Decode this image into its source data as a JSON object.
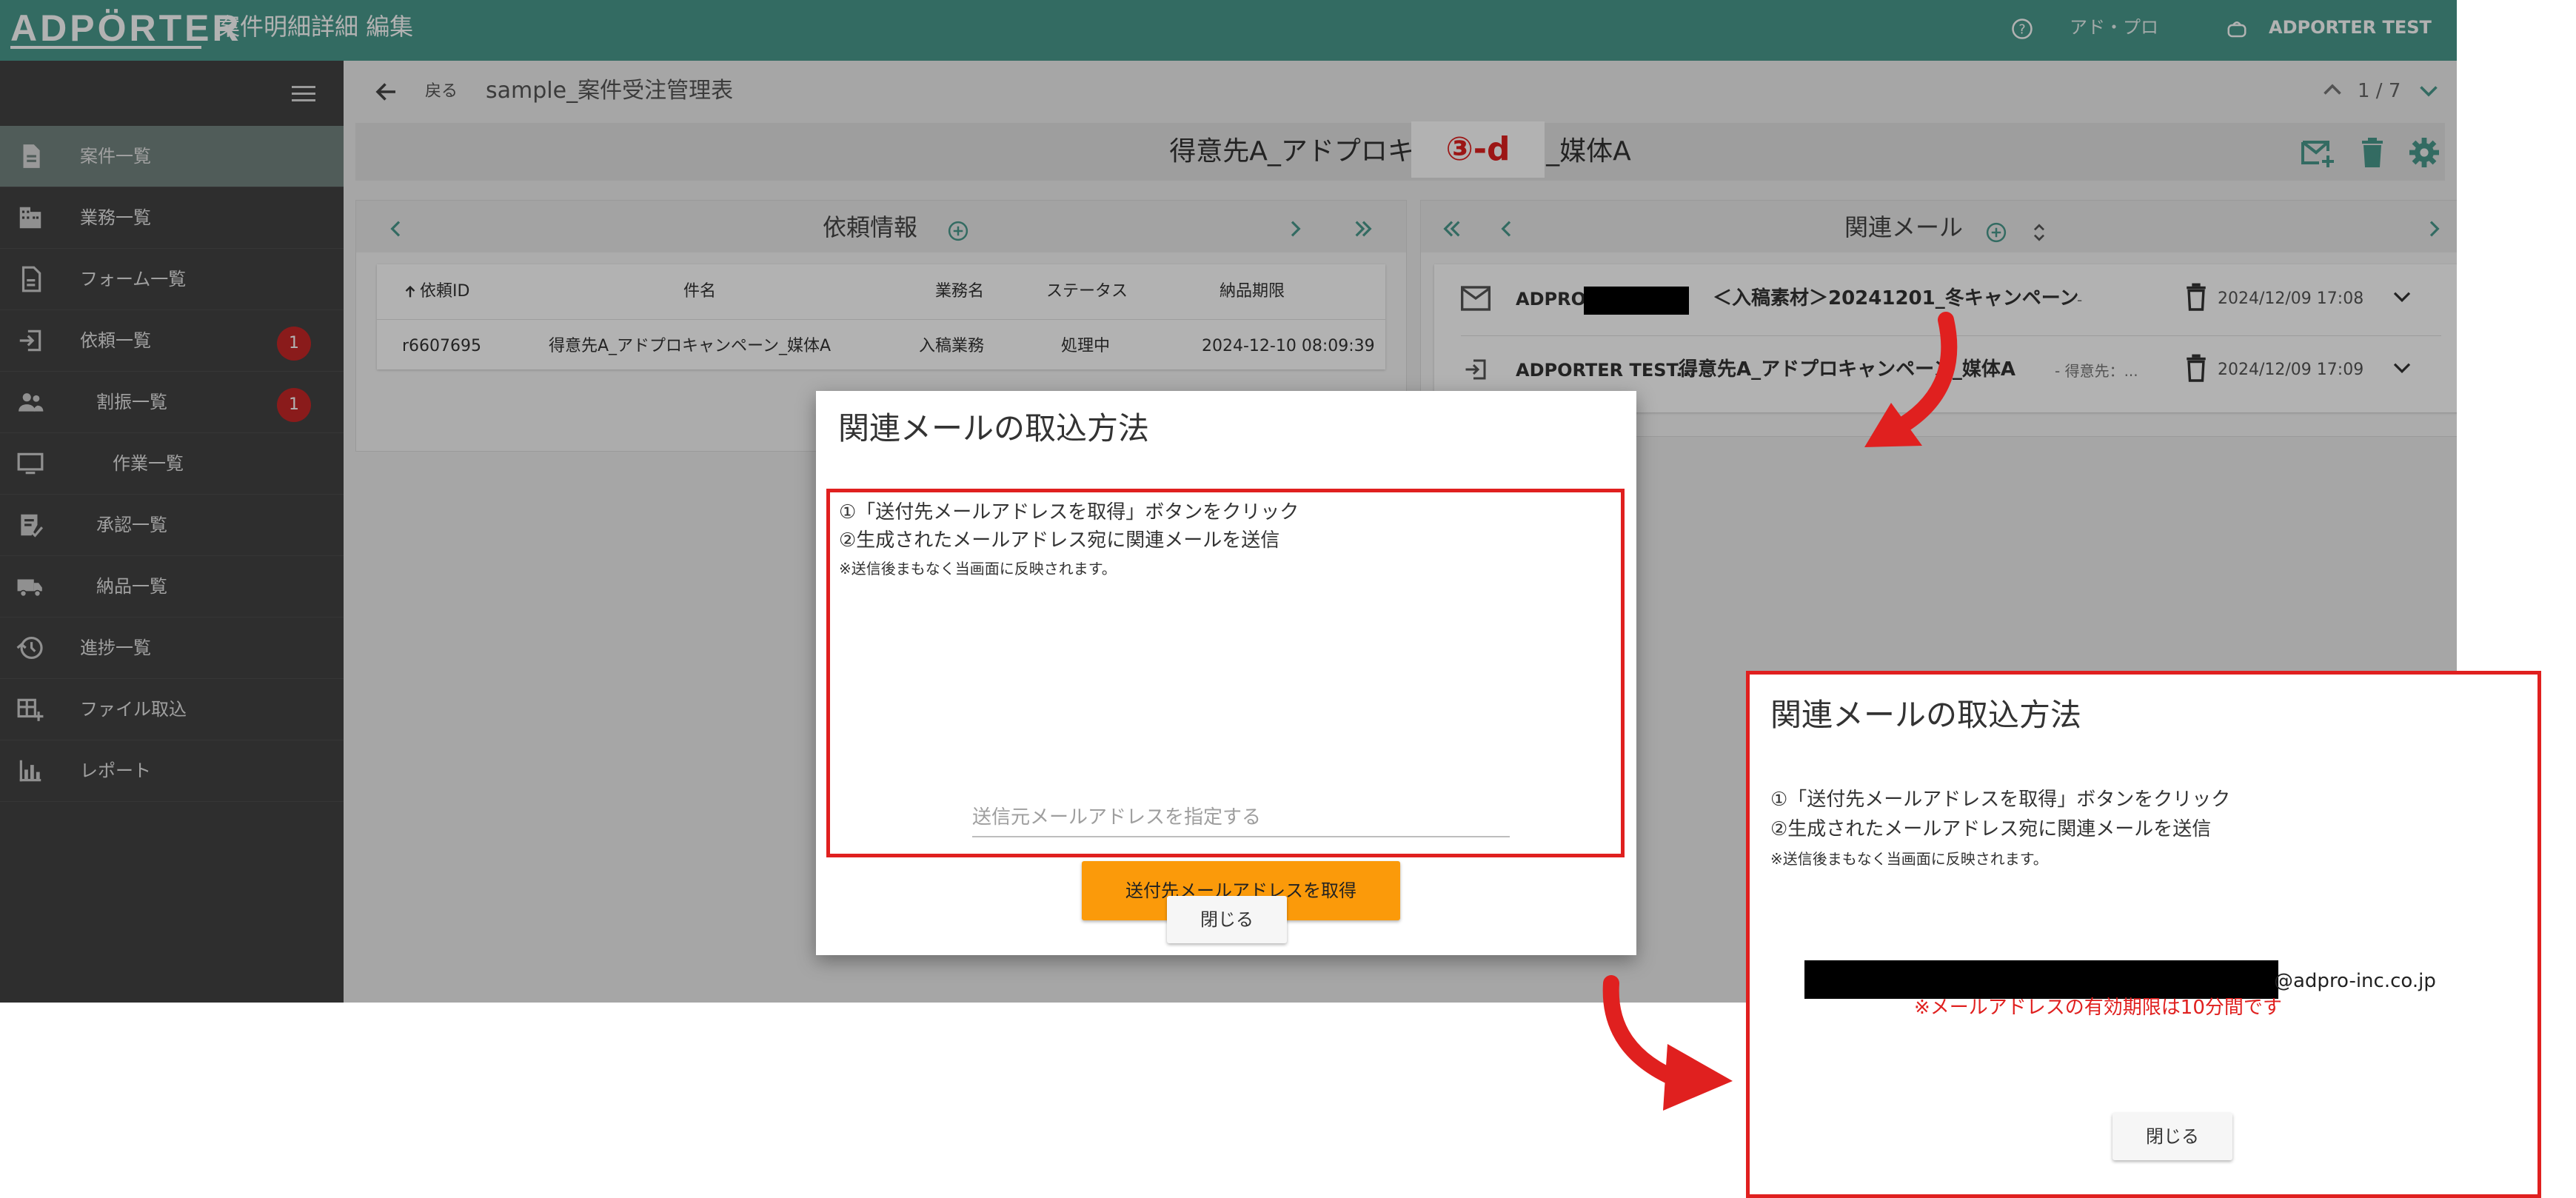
{
  "app": {
    "logo": "ADPÖRTER",
    "page_title": "案件明細詳細 編集",
    "help_label": "アド・プロ",
    "user_label": "ADPORTER TEST",
    "accent_color": "#4a9a8d"
  },
  "sidebar": {
    "items": [
      {
        "label": "案件一覧",
        "icon": "document-icon",
        "active": true
      },
      {
        "label": "業務一覧",
        "icon": "building-icon"
      },
      {
        "label": "フォーム一覧",
        "icon": "file-form-icon"
      },
      {
        "label": "依頼一覧",
        "icon": "sign-in-icon",
        "badge": "1"
      },
      {
        "label": "割振一覧",
        "icon": "people-icon",
        "badge": "1"
      },
      {
        "label": "作業一覧",
        "icon": "monitor-icon"
      },
      {
        "label": "承認一覧",
        "icon": "approval-icon"
      },
      {
        "label": "納品一覧",
        "icon": "truck-icon"
      },
      {
        "label": "進捗一覧",
        "icon": "history-icon"
      },
      {
        "label": "ファイル取込",
        "icon": "file-import-icon"
      },
      {
        "label": "レポート",
        "icon": "bar-chart-icon"
      }
    ]
  },
  "header": {
    "back_label": "戻る",
    "breadcrumb": "sample_案件受注管理表",
    "pager": "1 / 7"
  },
  "case": {
    "title": "得意先A_アドプロキャンペーン_媒体A",
    "step_label": "③-d"
  },
  "request_panel": {
    "title": "依頼情報",
    "columns": [
      "依頼ID",
      "件名",
      "業務名",
      "ステータス",
      "納品期限"
    ],
    "rows": [
      [
        "r6607695",
        "得意先A_アドプロキャンペーン_媒体A",
        "入稿業務",
        "処理中",
        "2024-12-10 08:09:39"
      ]
    ]
  },
  "mail_panel": {
    "title": "関連メール",
    "rows": [
      {
        "from": "ADPRO:",
        "subject": "＜入稿素材＞20241201_冬キャンペーン",
        "snippet": "-",
        "date": "2024/12/09 17:08",
        "icon": "envelope-icon"
      },
      {
        "from": "ADPORTER TEST...",
        "subject": "得意先A_アドプロキャンペーン_媒体A",
        "snippet": "- 得意先：...",
        "date": "2024/12/09 17:09",
        "icon": "sign-in-icon"
      }
    ]
  },
  "dialog": {
    "title": "関連メールの取込方法",
    "step1": "①「送付先メールアドレスを取得」ボタンをクリック",
    "step2": "②生成されたメールアドレス宛に関連メールを送信",
    "note": "※送信後まもなく当画面に反映されます。",
    "input_placeholder": "送信元メールアドレスを指定する",
    "get_button": "送付先メールアドレスを取得",
    "close_button": "閉じる"
  },
  "result_dialog": {
    "title": "関連メールの取込方法",
    "step1": "①「送付先メールアドレスを取得」ボタンをクリック",
    "step2": "②生成されたメールアドレス宛に関連メールを送信",
    "note": "※送信後まもなく当画面に反映されます。",
    "email_domain": "@adpro-inc.co.jp",
    "expiry_note": "※メールアドレスの有効期限は10分間です",
    "close_button": "閉じる"
  },
  "colors": {
    "highlight": "#e0201f",
    "button_orange": "#fb9a0a",
    "sidebar_bg": "#424242",
    "badge_red": "#c62828"
  }
}
